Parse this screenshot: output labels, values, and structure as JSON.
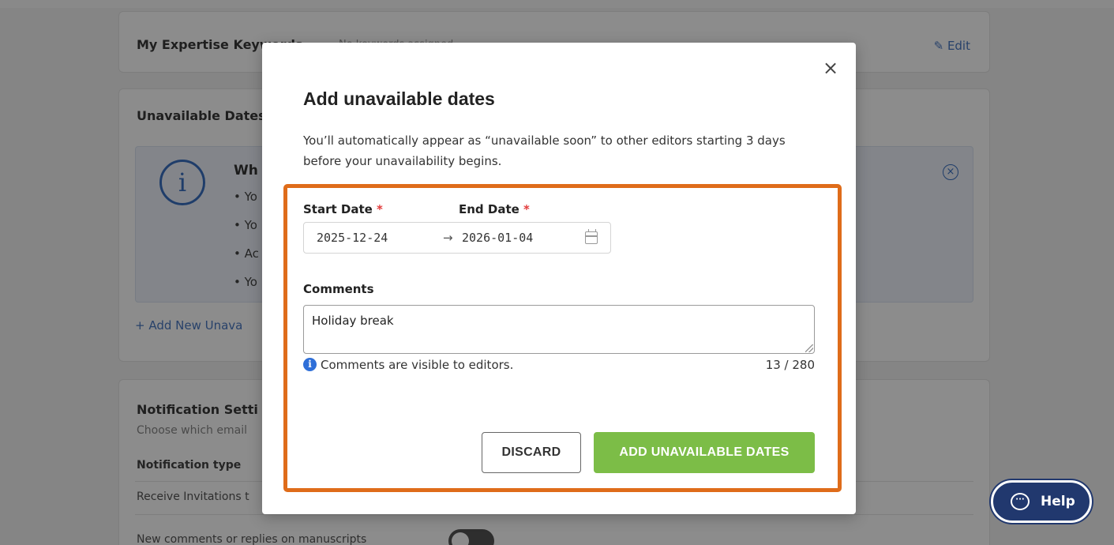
{
  "background": {
    "expertise": {
      "title": "My Expertise Keywords",
      "note": "No keywords assigned",
      "edit_label": "Edit"
    },
    "unavailable": {
      "title": "Unavailable Dates",
      "info_heading": "Wh",
      "bullets": [
        "Yo",
        "Yo",
        "Ac",
        "Yo"
      ],
      "add_link": "+ Add New Unava"
    },
    "notifications": {
      "title": "Notification Setti",
      "subtitle": "Choose which email",
      "type_header": "Notification type",
      "row1": "Receive Invitations t",
      "row2": "New comments or replies on manuscripts"
    }
  },
  "modal": {
    "close_glyph": "×",
    "title": "Add unavailable dates",
    "description": "You’ll automatically appear as “unavailable soon” to other editors starting 3 days before your unavailability begins.",
    "start_label": "Start Date",
    "end_label": "End Date",
    "required_mark": "*",
    "start_value": "2025-12-24",
    "arrow": "→",
    "end_value": "2026-01-04",
    "comments_label": "Comments",
    "comments_value": "Holiday break",
    "hint": "Comments are visible to editors.",
    "counter": "13 / 280",
    "discard_label": "DISCARD",
    "submit_label": "ADD UNAVAILABLE DATES"
  },
  "help": {
    "label": "Help"
  },
  "colors": {
    "highlight": "#df6c1a",
    "submit": "#7cbd47",
    "help": "#21386e",
    "required": "#e23b3b"
  },
  "icons": [
    "close-icon",
    "calendar-icon",
    "info-icon",
    "chat-icon",
    "edit-icon",
    "dismiss-icon"
  ]
}
